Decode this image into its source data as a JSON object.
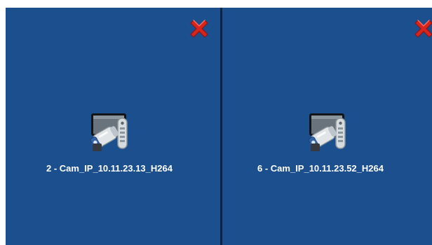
{
  "viewer": {
    "panes": [
      {
        "title": "2 - Cam_IP_10.11.23.13_H264",
        "icon": "camera-tv-remote-icon",
        "close_icon": "close-icon"
      },
      {
        "title": "6 - Cam_IP_10.11.23.52_H264",
        "icon": "camera-tv-remote-icon",
        "close_icon": "close-icon"
      }
    ]
  },
  "colors": {
    "pane_background": "#1b4f8e",
    "divider": "#0b2446",
    "close": "#d8241d",
    "text": "#ffffff"
  }
}
